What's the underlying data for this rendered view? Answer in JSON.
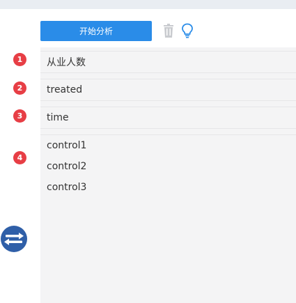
{
  "toolbar": {
    "start_label": "开始分析"
  },
  "fields": [
    {
      "badge": "1",
      "label": "从业人数"
    },
    {
      "badge": "2",
      "label": "treated"
    },
    {
      "badge": "3",
      "label": "time"
    },
    {
      "badge": "4",
      "labels": [
        "control1",
        "control2",
        "control3"
      ]
    }
  ],
  "colors": {
    "accent": "#2a8ce8",
    "badge": "#e73e45",
    "collapse": "#2f5fa8"
  }
}
